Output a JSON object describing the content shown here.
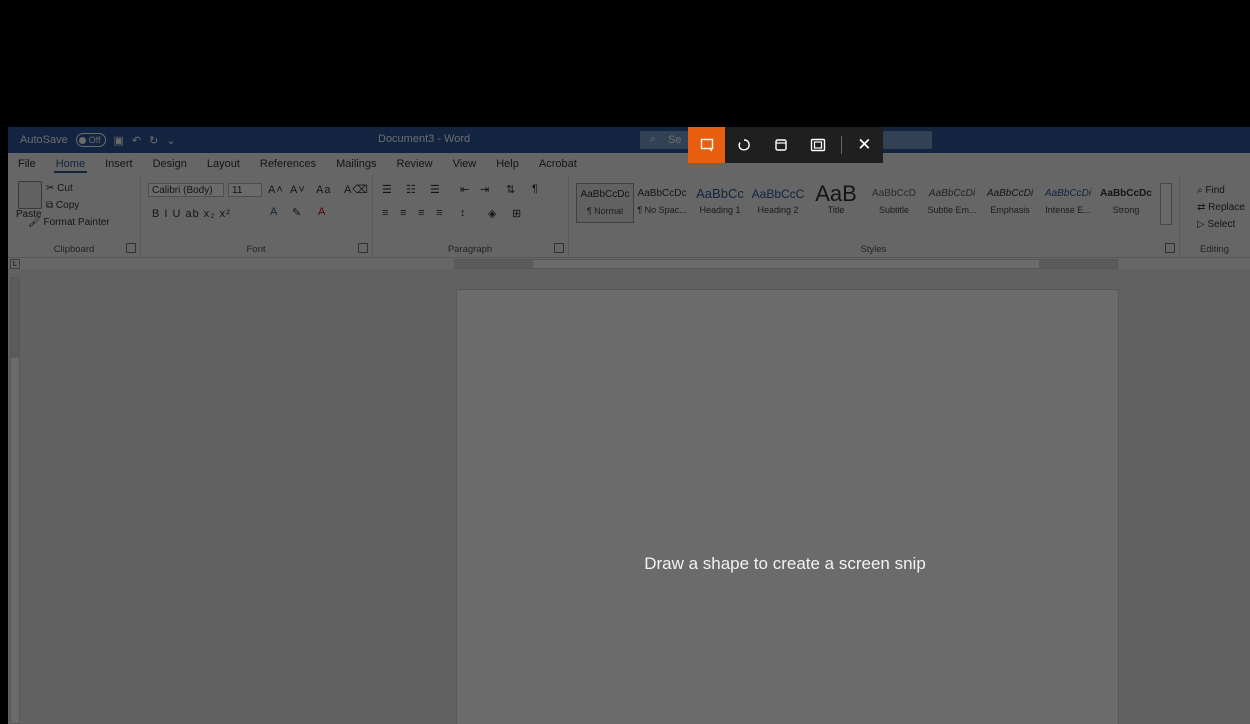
{
  "titlebar": {
    "autosave_label": "AutoSave",
    "autosave_state": "Off",
    "doc_title": "Document3 - Word",
    "search_placeholder": "Se"
  },
  "tabs": [
    "File",
    "Home",
    "Insert",
    "Design",
    "Layout",
    "References",
    "Mailings",
    "Review",
    "View",
    "Help",
    "Acrobat"
  ],
  "active_tab": "Home",
  "clipboard": {
    "group_label": "Clipboard",
    "paste": "Paste",
    "cut": "Cut",
    "copy": "Copy",
    "format_painter": "Format Painter"
  },
  "font": {
    "group_label": "Font",
    "family": "Calibri (Body)",
    "size": "11",
    "grow": "A˄",
    "shrink": "A˅",
    "case": "Aa",
    "row2": "B  I  U  ab  x₂  x²"
  },
  "paragraph": {
    "group_label": "Paragraph",
    "pilcrow": "¶"
  },
  "styles": {
    "group_label": "Styles",
    "items": [
      {
        "sample": "AaBbCcDc",
        "name": "¶ Normal"
      },
      {
        "sample": "AaBbCcDc",
        "name": "¶ No Spac..."
      },
      {
        "sample": "AaBbCc",
        "name": "Heading 1"
      },
      {
        "sample": "AaBbCcC",
        "name": "Heading 2"
      },
      {
        "sample": "AaB",
        "name": "Title"
      },
      {
        "sample": "AaBbCcD",
        "name": "Subtitle"
      },
      {
        "sample": "AaBbCcDi",
        "name": "Subtle Em..."
      },
      {
        "sample": "AaBbCcDi",
        "name": "Emphasis"
      },
      {
        "sample": "AaBbCcDi",
        "name": "Intense E..."
      },
      {
        "sample": "AaBbCcDc",
        "name": "Strong"
      }
    ]
  },
  "editing": {
    "group_label": "Editing",
    "find": "Find",
    "replace": "Replace",
    "select": "Select"
  },
  "ruler_corner": "L",
  "snip": {
    "hint": "Draw a shape to create a screen snip",
    "close_glyph": "✕"
  }
}
